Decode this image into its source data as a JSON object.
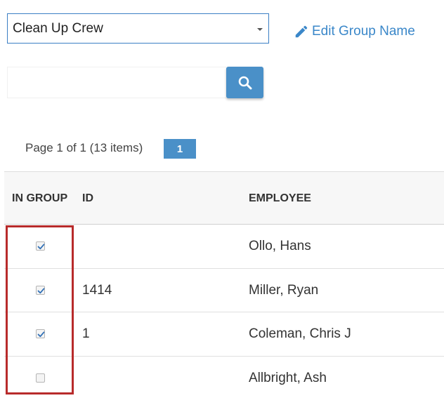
{
  "group_select": {
    "selected": "Clean Up Crew"
  },
  "edit_link": {
    "label": "Edit Group Name"
  },
  "search": {
    "placeholder": ""
  },
  "pager": {
    "info": "Page 1 of 1 (13 items)",
    "current_page": "1"
  },
  "table": {
    "columns": [
      "IN GROUP",
      "ID",
      "EMPLOYEE"
    ],
    "rows": [
      {
        "in_group": true,
        "id": "",
        "employee": "Ollo, Hans"
      },
      {
        "in_group": true,
        "id": "1414",
        "employee": "Miller, Ryan"
      },
      {
        "in_group": true,
        "id": "1",
        "employee": "Coleman, Chris J"
      },
      {
        "in_group": false,
        "id": "",
        "employee": "Allbright, Ash"
      }
    ]
  },
  "colors": {
    "accent": "#4a90c8",
    "link": "#3a87c9",
    "highlight": "#b82b2b",
    "select_border": "#3b7fc4"
  },
  "icons": {
    "edit": "pencil-icon",
    "search": "search-icon",
    "dropdown": "caret-down-icon",
    "check": "checkmark-icon"
  }
}
